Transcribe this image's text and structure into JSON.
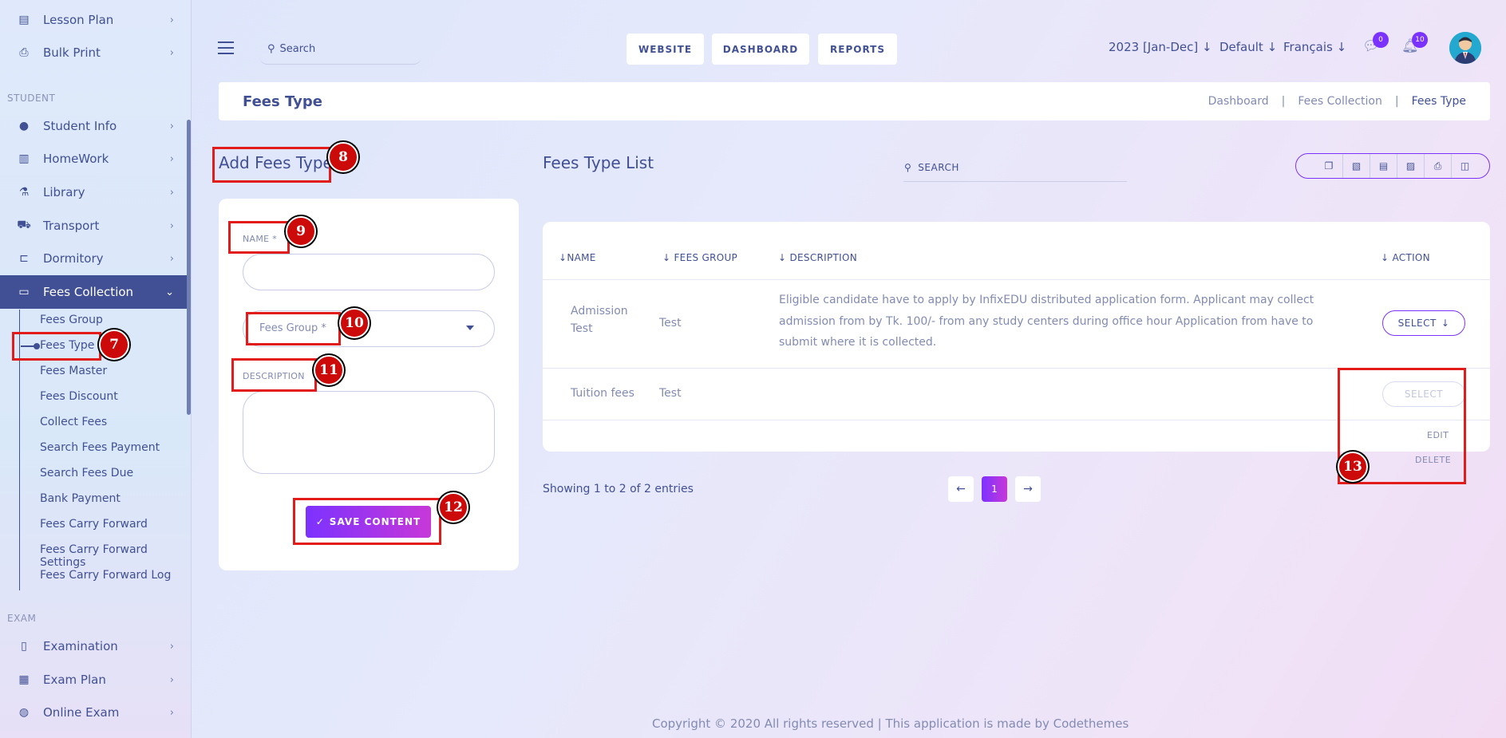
{
  "sidebar": {
    "top_items": [
      {
        "label": "Lesson Plan",
        "icon": "list-icon"
      },
      {
        "label": "Bulk Print",
        "icon": "printer-icon"
      }
    ],
    "student_section": "STUDENT",
    "student_items": [
      {
        "label": "Student Info",
        "icon": "user-icon"
      },
      {
        "label": "HomeWork",
        "icon": "book-icon"
      },
      {
        "label": "Library",
        "icon": "library-icon"
      },
      {
        "label": "Transport",
        "icon": "bus-icon"
      },
      {
        "label": "Dormitory",
        "icon": "bed-icon"
      },
      {
        "label": "Fees Collection",
        "icon": "money-icon"
      }
    ],
    "fees_sub_items": [
      "Fees Group",
      "Fees Type",
      "Fees Master",
      "Fees Discount",
      "Collect Fees",
      "Search Fees Payment",
      "Search Fees Due",
      "Bank Payment",
      "Fees Carry Forward",
      "Fees Carry Forward Settings",
      "Fees Carry Forward Log"
    ],
    "exam_section": "EXAM",
    "exam_items": [
      {
        "label": "Examination",
        "icon": "map-icon"
      },
      {
        "label": "Exam Plan",
        "icon": "calculator-icon"
      },
      {
        "label": "Online Exam",
        "icon": "globe-icon"
      }
    ]
  },
  "header": {
    "search_placeholder": "Search",
    "buttons": [
      "WEBSITE",
      "DASHBOARD",
      "REPORTS"
    ],
    "year": "2023 [Jan-Dec]",
    "theme": "Default",
    "language": "Français",
    "messages_count": "0",
    "notifications_count": "10"
  },
  "page": {
    "title": "Fees Type",
    "breadcrumbs": [
      "Dashboard",
      "Fees Collection",
      "Fees Type"
    ]
  },
  "form": {
    "heading": "Add Fees Type",
    "name_label": "NAME *",
    "fees_group_placeholder": "Fees Group *",
    "description_label": "DESCRIPTION",
    "save_label": "SAVE CONTENT"
  },
  "list": {
    "heading": "Fees Type List",
    "search_placeholder": "SEARCH",
    "columns": [
      "NAME",
      "FEES GROUP",
      "DESCRIPTION",
      "ACTION"
    ],
    "rows": [
      {
        "name_line1": "Admission",
        "name_line2": "Test",
        "group": "Test",
        "description": "Eligible candidate have to apply by InfixEDU distributed application form. Applicant may collect admission from by Tk. 100/- from any study centers during office hour Application from have to submit where it is collected.",
        "action": "SELECT"
      },
      {
        "name_line1": "Tuition fees",
        "name_line2": "",
        "group": "Test",
        "description": "",
        "action": "SELECT"
      }
    ],
    "dropdown_items": [
      "EDIT",
      "DELETE"
    ],
    "showing": "Showing 1 to 2 of 2 entries",
    "page": "1"
  },
  "annotations": [
    "7",
    "8",
    "9",
    "10",
    "11",
    "12",
    "13"
  ],
  "footer": "Copyright © 2020 All rights reserved | This application is made by Codethemes",
  "colors": {
    "primary": "#415094",
    "accent": "#7c32ff",
    "accent2": "#c738d8",
    "marker": "#e21b1b"
  }
}
